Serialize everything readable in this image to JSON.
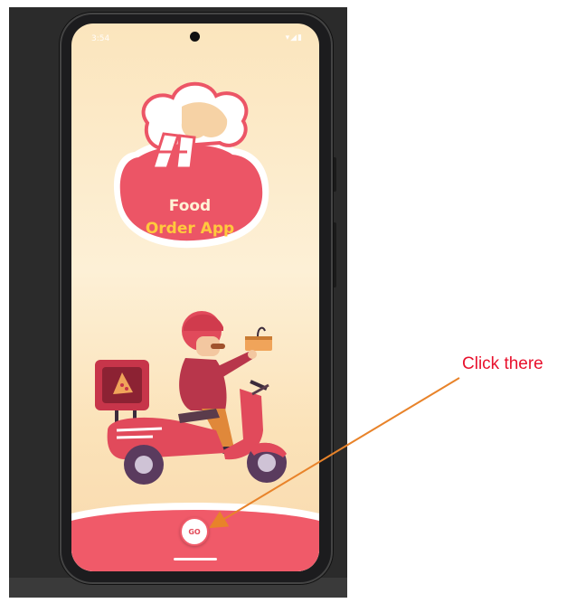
{
  "status_bar": {
    "time": "3:54",
    "icons": "▾◢▮"
  },
  "app": {
    "logo_line1": "Food",
    "logo_line2": "Order App",
    "go_label": "GO"
  },
  "annotation": {
    "text": "Click there",
    "color": "#e8112d",
    "arrow_color": "#e8832a"
  },
  "colors": {
    "brand_red": "#f05a69",
    "brand_yellow": "#ffc93d",
    "background_cream": "#fdf0d6"
  }
}
